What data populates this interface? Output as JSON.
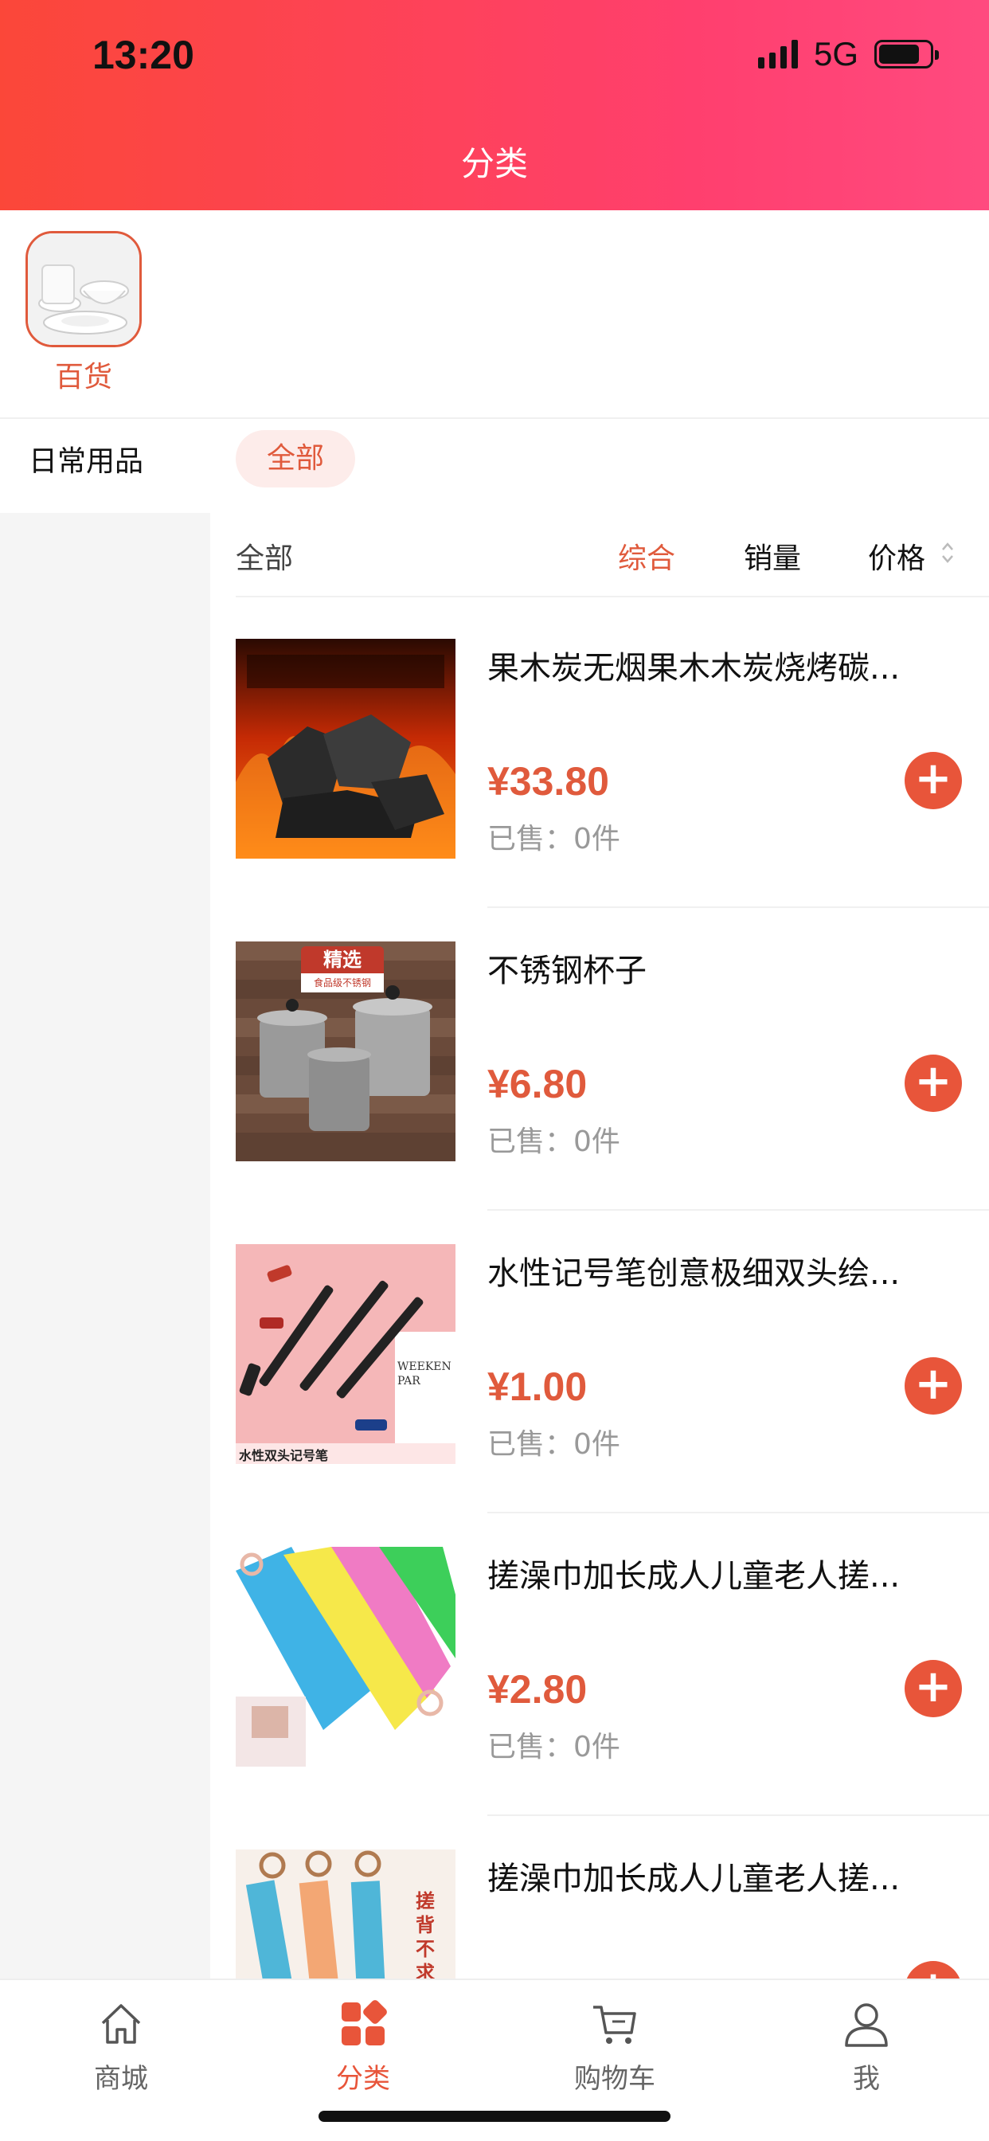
{
  "status_bar": {
    "time": "13:20",
    "network": "5G"
  },
  "header": {
    "title": "分类"
  },
  "top_categories": [
    {
      "label": "百货",
      "active": true
    }
  ],
  "sidebar": {
    "items": [
      {
        "label": "日常用品",
        "active": true
      }
    ]
  },
  "sub_categories": [
    {
      "label": "全部",
      "active": true
    }
  ],
  "sort_bar": {
    "left_label": "全部",
    "options": [
      {
        "label": "综合",
        "active": true
      },
      {
        "label": "销量",
        "active": false
      },
      {
        "label": "价格",
        "active": false
      }
    ]
  },
  "products": [
    {
      "name": "果木炭无烟果木木炭烧烤碳...",
      "price": "¥33.80",
      "sold": "已售：0件",
      "image": "charcoal"
    },
    {
      "name": "不锈钢杯子",
      "price": "¥6.80",
      "sold": "已售：0件",
      "image": "steel-cups",
      "badge": "精选",
      "badge_sub": "食品级不锈钢"
    },
    {
      "name": "水性记号笔创意极细双头绘...",
      "price": "¥1.00",
      "sold": "已售：0件",
      "image": "markers",
      "caption": "水性双头记号笔",
      "paper_text": "WEEKEN PAR"
    },
    {
      "name": "搓澡巾加长成人儿童老人搓...",
      "price": "¥2.80",
      "sold": "已售：0件",
      "image": "bath-towels"
    },
    {
      "name": "搓澡巾加长成人儿童老人搓...",
      "price": "",
      "sold": "",
      "image": "bath-straps",
      "side_text": "搓背不求"
    }
  ],
  "tab_bar": {
    "items": [
      {
        "label": "商城",
        "icon": "home-icon",
        "active": false
      },
      {
        "label": "分类",
        "icon": "category-icon",
        "active": true
      },
      {
        "label": "购物车",
        "icon": "cart-icon",
        "active": false
      },
      {
        "label": "我",
        "icon": "user-icon",
        "active": false
      }
    ]
  },
  "colors": {
    "accent": "#e8553a",
    "header_start": "#fb4739",
    "header_end": "#ff4a7f"
  }
}
